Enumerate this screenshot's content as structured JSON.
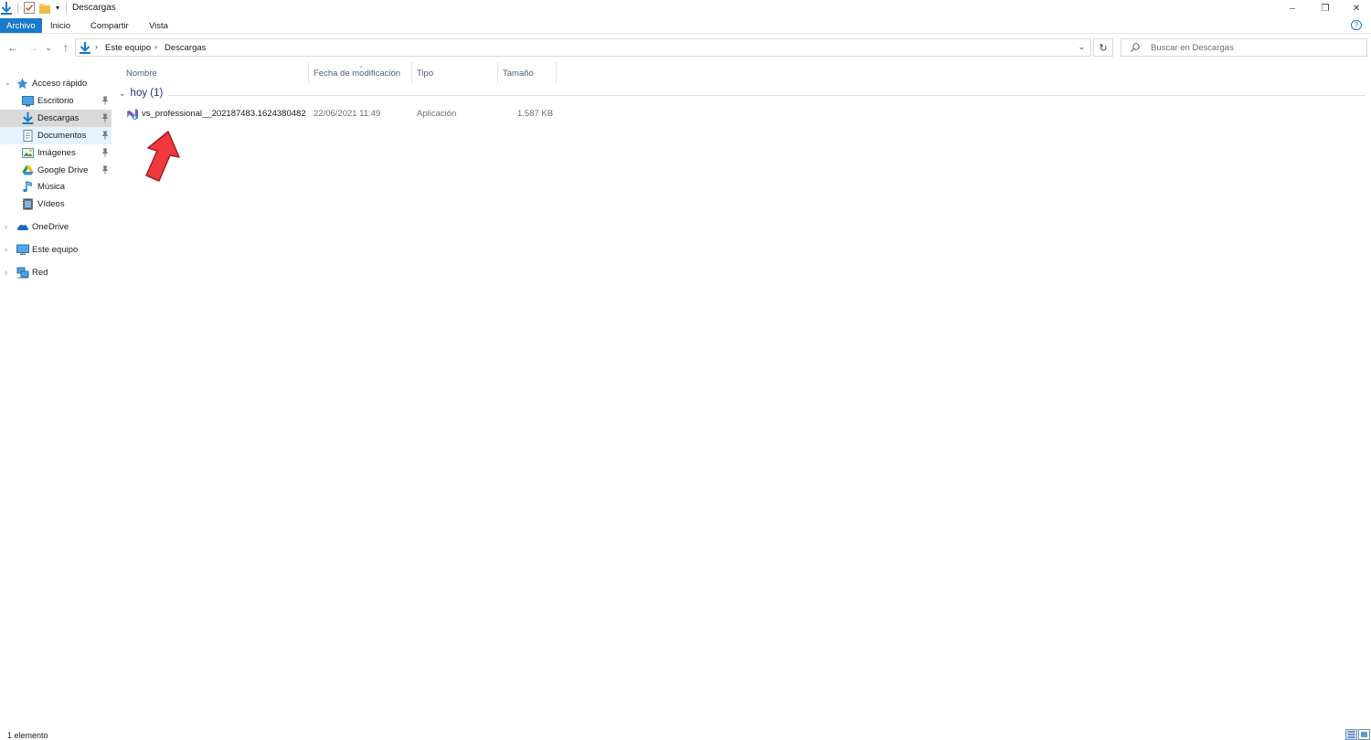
{
  "window": {
    "title": "Descargas",
    "minimize_glyph": "–",
    "maximize_glyph": "❐",
    "close_glyph": "✕"
  },
  "ribbon": {
    "tabs": [
      "Archivo",
      "Inicio",
      "Compartir",
      "Vista"
    ],
    "help_glyph": "?"
  },
  "navigation": {
    "back_glyph": "←",
    "forward_glyph": "→",
    "recent_glyph": "⌄",
    "up_glyph": "↑"
  },
  "address": {
    "crumbs": [
      "Este equipo",
      "Descargas"
    ],
    "dropdown_glyph": "⌄",
    "refresh_glyph": "↻"
  },
  "search": {
    "placeholder": "Buscar en Descargas"
  },
  "sidebar": {
    "quick_access": "Acceso rápido",
    "items": [
      {
        "label": "Escritorio",
        "icon": "desktop-icon",
        "pinned": true
      },
      {
        "label": "Descargas",
        "icon": "download-icon",
        "pinned": true
      },
      {
        "label": "Documentos",
        "icon": "documents-icon",
        "pinned": true
      },
      {
        "label": "Imágenes",
        "icon": "pictures-icon",
        "pinned": true
      },
      {
        "label": "Google Drive",
        "icon": "google-drive-icon",
        "pinned": true
      },
      {
        "label": "Música",
        "icon": "music-icon",
        "pinned": false
      },
      {
        "label": "Vídeos",
        "icon": "videos-icon",
        "pinned": false
      }
    ],
    "roots": [
      {
        "label": "OneDrive",
        "icon": "onedrive-icon"
      },
      {
        "label": "Este equipo",
        "icon": "this-pc-icon"
      },
      {
        "label": "Red",
        "icon": "network-icon"
      }
    ]
  },
  "columns": [
    "Nombre",
    "Fecha de modificación",
    "Tipo",
    "Tamaño"
  ],
  "groups": [
    {
      "header": "hoy (1)",
      "files": [
        {
          "name": "vs_professional__202187483.1624380482",
          "modified": "22/06/2021 11:49",
          "type": "Aplicación",
          "size": "1.587 KB"
        }
      ]
    }
  ],
  "status_bar": {
    "item_count": "1 elemento"
  },
  "colors": {
    "accent": "#1979ca",
    "selection": "#cce8ff",
    "annotation_arrow": "#f0393f",
    "group_header": "#1e3287"
  }
}
